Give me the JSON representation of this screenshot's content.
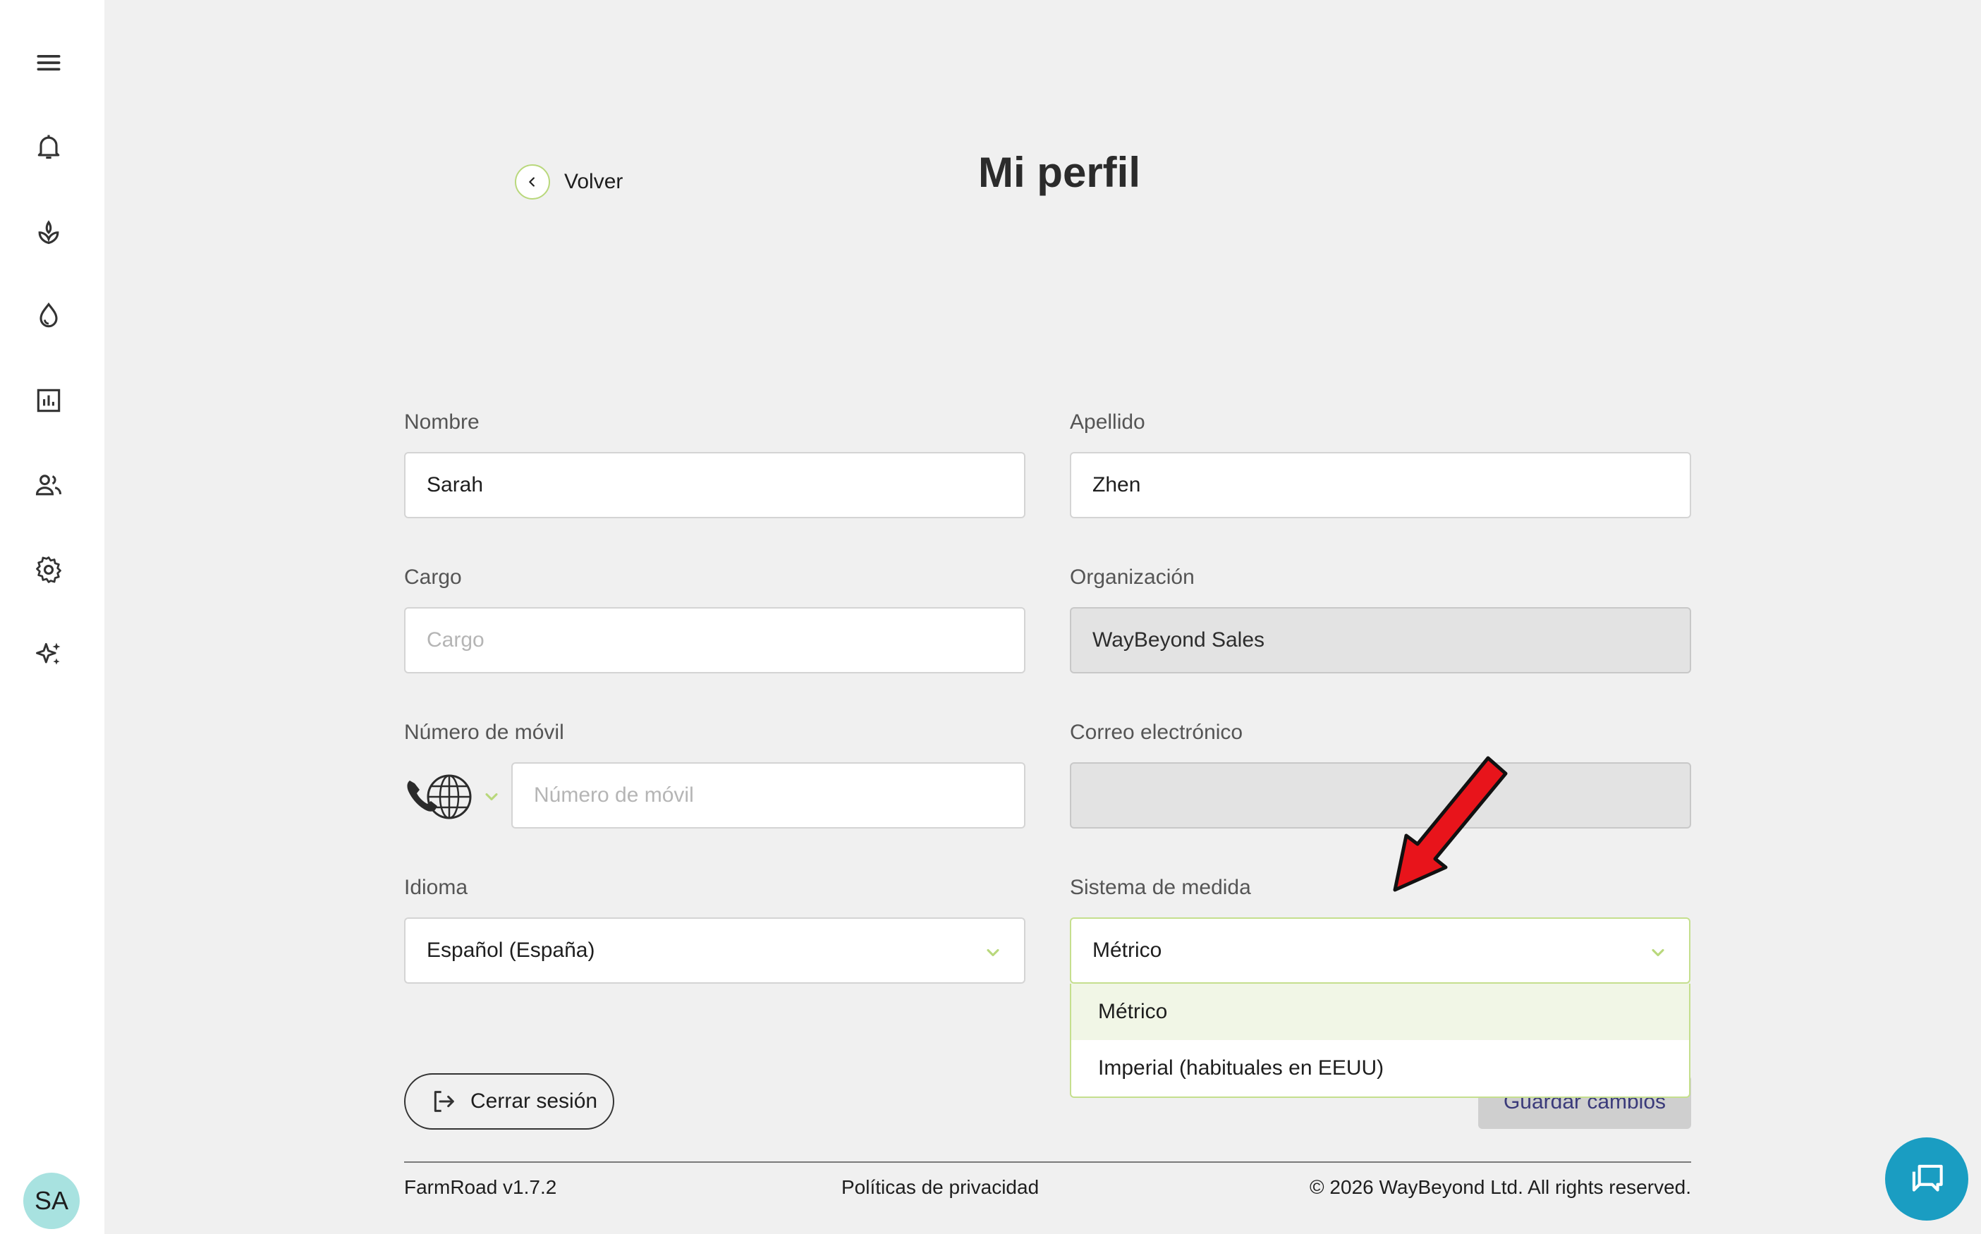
{
  "nav": {
    "items": [
      {
        "icon": "menu-icon"
      },
      {
        "icon": "bell-icon"
      },
      {
        "icon": "plant-icon"
      },
      {
        "icon": "water-drop-icon"
      },
      {
        "icon": "chart-icon"
      },
      {
        "icon": "users-icon"
      },
      {
        "icon": "gear-icon"
      },
      {
        "icon": "sparkles-icon"
      }
    ],
    "avatar_initials": "SA"
  },
  "header": {
    "back_label": "Volver",
    "title": "Mi perfil"
  },
  "form": {
    "first_name": {
      "label": "Nombre",
      "value": "Sarah"
    },
    "last_name": {
      "label": "Apellido",
      "value": "Zhen"
    },
    "position": {
      "label": "Cargo",
      "value": "",
      "placeholder": "Cargo"
    },
    "organization": {
      "label": "Organización",
      "value": "WayBeyond Sales"
    },
    "mobile": {
      "label": "Número de móvil",
      "value": "",
      "placeholder": "Número de móvil"
    },
    "email": {
      "label": "Correo electrónico",
      "value": ""
    },
    "language": {
      "label": "Idioma",
      "value": "Español (España)"
    },
    "measurement": {
      "label": "Sistema de medida",
      "value": "Métrico",
      "options": [
        "Métrico",
        "Imperial (habituales en EEUU)"
      ],
      "selected_index": 0
    }
  },
  "actions": {
    "logout_label": "Cerrar sesión",
    "save_label": "Guardar cambios"
  },
  "footer": {
    "version": "FarmRoad v1.7.2",
    "privacy": "Políticas de privacidad",
    "copyright": "© 2026 WayBeyond Ltd. All rights reserved."
  },
  "colors": {
    "accent": "#b9d87c",
    "chat": "#1a9dc2",
    "avatar": "#a8e2e0",
    "annotation_arrow": "#e8141b"
  }
}
